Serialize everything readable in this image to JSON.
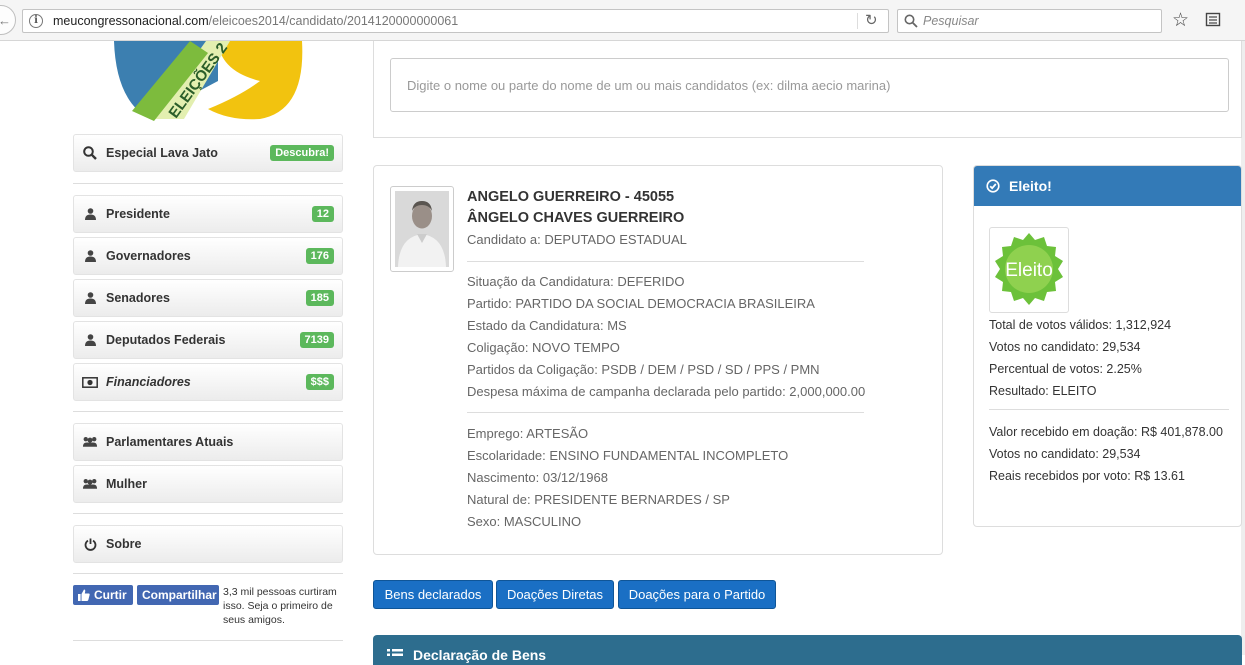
{
  "browser": {
    "url_domain": "meucongressonacional.com",
    "url_path": "/eleicoes2014/candidato/2014120000000061",
    "search_placeholder": "Pesquisar"
  },
  "logo": {
    "text": "ELEIÇÕES 2"
  },
  "sidebar": {
    "lava_jato": {
      "label": "Especial Lava Jato",
      "badge": "Descubra!"
    },
    "items": [
      {
        "label": "Presidente",
        "badge": "12"
      },
      {
        "label": "Governadores",
        "badge": "176"
      },
      {
        "label": "Senadores",
        "badge": "185"
      },
      {
        "label": "Deputados Federais",
        "badge": "7139"
      },
      {
        "label": "Financiadores",
        "badge": "$$$"
      }
    ],
    "groups": [
      {
        "label": "Parlamentares Atuais"
      },
      {
        "label": "Mulher"
      }
    ],
    "about": {
      "label": "Sobre"
    }
  },
  "facebook": {
    "like": "Curtir",
    "share": "Compartilhar",
    "text": "3,3 mil pessoas curtiram isso. Seja o primeiro de seus amigos."
  },
  "search": {
    "placeholder": "Digite o nome ou parte do nome de um ou mais candidatos (ex: dilma aecio marina)"
  },
  "candidate": {
    "title": "ANGELO GUERREIRO - 45055",
    "full_name": "ÂNGELO CHAVES GUERREIRO",
    "office": "Candidato a: DEPUTADO ESTADUAL",
    "details": [
      "Situação da Candidatura: DEFERIDO",
      "Partido: PARTIDO DA SOCIAL DEMOCRACIA BRASILEIRA",
      "Estado da Candidatura: MS",
      "Coligação: NOVO TEMPO",
      "Partidos da Coligação: PSDB / DEM / PSD / SD / PPS / PMN",
      "Despesa máxima de campanha declarada pelo partido: 2,000,000.00"
    ],
    "personal": [
      "Emprego: ARTESÃO",
      "Escolaridade: ENSINO FUNDAMENTAL INCOMPLETO",
      "Nascimento: 03/12/1968",
      "Natural de: PRESIDENTE BERNARDES / SP",
      "Sexo: MASCULINO"
    ]
  },
  "result": {
    "header": "Eleito!",
    "seal_text": "Eleito",
    "stats": [
      "Total de votos válidos: 1,312,924",
      "Votos no candidato: 29,534",
      "Percentual de votos: 2.25%",
      "Resultado: ELEITO"
    ],
    "donations": [
      "Valor recebido em doação: R$ 401,878.00",
      "Votos no candidato: 29,534",
      "Reais recebidos por voto: R$ 13.61"
    ]
  },
  "actions": {
    "assets": "Bens declarados",
    "direct": "Doações Diretas",
    "party": "Doações para o Partido"
  },
  "bottom_panel": {
    "title": "Declaração de Bens"
  },
  "colors": {
    "primary": "#337ab7",
    "button": "#1a6fc4",
    "badge_green": "#5cb85c",
    "facebook": "#4267b2",
    "bottom_panel": "#2d6d8e"
  }
}
